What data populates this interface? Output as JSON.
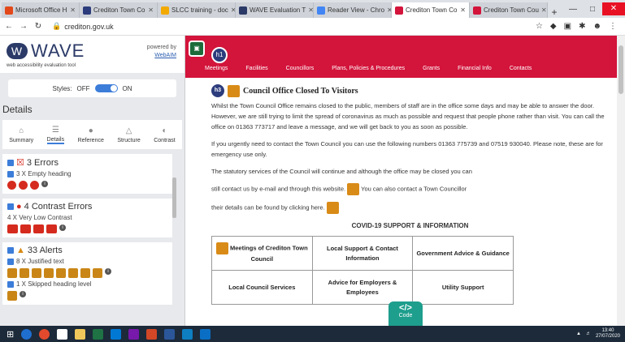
{
  "browser": {
    "tabs": [
      {
        "label": "Microsoft Office H",
        "color": "#e3481b"
      },
      {
        "label": "Crediton Town Co",
        "color": "#2c3c7c"
      },
      {
        "label": "SLCC training - doc",
        "color": "#f2a900"
      },
      {
        "label": "WAVE Evaluation T",
        "color": "#2b3a67"
      },
      {
        "label": "Reader View - Chro",
        "color": "#4285f4"
      },
      {
        "label": "Crediton Town Co",
        "color": "#d3143b",
        "active": true
      },
      {
        "label": "Crediton Town Cou",
        "color": "#d3143b"
      }
    ],
    "new_tab": "+",
    "url": "crediton.gov.uk"
  },
  "wave": {
    "logo": "WAVE",
    "subtitle": "web accessibility evaluation tool",
    "powered_by": "powered by",
    "webaim": "WebAIM",
    "styles_label": "Styles:",
    "off": "OFF",
    "on": "ON",
    "details_title": "Details",
    "tabs": [
      "Summary",
      "Details",
      "Reference",
      "Structure",
      "Contrast"
    ],
    "errors": {
      "title": "3 Errors",
      "sub": "3 X Empty heading"
    },
    "contrast": {
      "title": "4 Contrast Errors",
      "sub": "4 X Very Low Contrast"
    },
    "alerts": {
      "title": "33 Alerts",
      "sub1": "8 X Justified text",
      "sub2": "1 X Skipped heading level"
    }
  },
  "site": {
    "menu": [
      "Meetings",
      "Facilities",
      "Councillors",
      "Plans, Policies & Procedures",
      "Grants",
      "Financial Info",
      "Contacts"
    ],
    "heading": "Council Office Closed To Visitors",
    "p1": "Whilst the Town Council Office remains closed to the public, members of staff are in the office some days and may be able to answer the door. However, we are still trying to limit the spread of coronavirus as much as possible and request that people phone rather than visit. You can call the office on 01363 773717 and leave a message, and we will get back to you as soon as possible.",
    "p2": "If you urgently need to contact the Town Council you can use the following numbers 01363 775739 and 07519 930040.  Please note, these are for emergency use only.",
    "p3": "The statutory services of the Council will continue and although the office may be closed you can",
    "p4a": "still contact us by e-mail and through this website.",
    "p4b": "You can also contact a Town Councillor",
    "p5": "their details can be found by clicking here.",
    "covid": "COVID-19 SUPPORT & INFORMATION",
    "table": [
      [
        "Meetings of Crediton Town Council",
        "Local Support & Contact Information",
        "Government Advice & Guidance"
      ],
      [
        "Local Council Services",
        "Advice for Employers & Employees",
        "Utility Support"
      ]
    ]
  },
  "code_button": "Code",
  "tray": {
    "time": "13:40",
    "date": "27/07/2020"
  }
}
